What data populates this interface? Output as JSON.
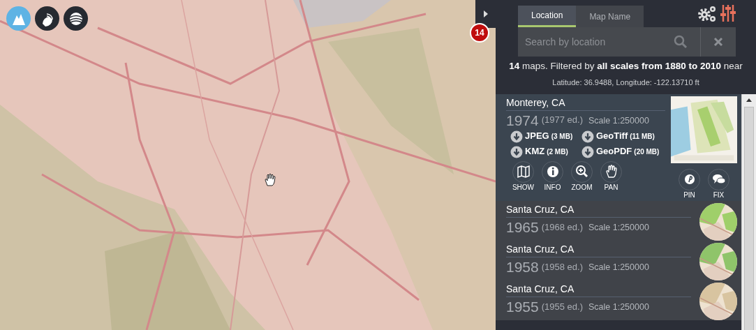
{
  "base_layers": [
    {
      "selected": true
    },
    {
      "selected": false
    },
    {
      "selected": false
    }
  ],
  "result_badge": "14",
  "tabs": [
    {
      "label": "Location",
      "selected": true
    },
    {
      "label": "Map Name",
      "selected": false
    }
  ],
  "search": {
    "placeholder": "Search by location"
  },
  "summary": "**14** maps. Filtered by **all scales from 1880 to 2010** near",
  "coordinates": "Latitude: 36.9488, Longitude: -122.13710 ft",
  "results": [
    {
      "title": "Monterey, CA",
      "year": "1974",
      "edition": "(1977 ed.)",
      "scale": "Scale 1:250000",
      "expanded": true,
      "downloads": [
        {
          "format": "JPEG",
          "size": "(3 MB)"
        },
        {
          "format": "GeoTiff",
          "size": "(11 MB)"
        },
        {
          "format": "KMZ",
          "size": "(2 MB)"
        },
        {
          "format": "GeoPDF",
          "size": "(20 MB)"
        }
      ],
      "actions": [
        {
          "kind": "show",
          "label": "SHOW"
        },
        {
          "kind": "info",
          "label": "INFO"
        },
        {
          "kind": "zoom",
          "label": "ZOOM"
        },
        {
          "kind": "pan",
          "label": "PAN"
        }
      ],
      "share": [
        {
          "kind": "pin",
          "label": "PIN"
        },
        {
          "kind": "fix",
          "label": "FIX"
        }
      ]
    },
    {
      "title": "Santa Cruz, CA",
      "year": "1965",
      "edition": "(1968 ed.)",
      "scale": "Scale 1:250000",
      "expanded": false
    },
    {
      "title": "Santa Cruz, CA",
      "year": "1958",
      "edition": "(1958 ed.)",
      "scale": "Scale 1:250000",
      "expanded": false
    },
    {
      "title": "Santa Cruz, CA",
      "year": "1955",
      "edition": "(1955 ed.)",
      "scale": "Scale 1:250000",
      "expanded": false
    }
  ]
}
